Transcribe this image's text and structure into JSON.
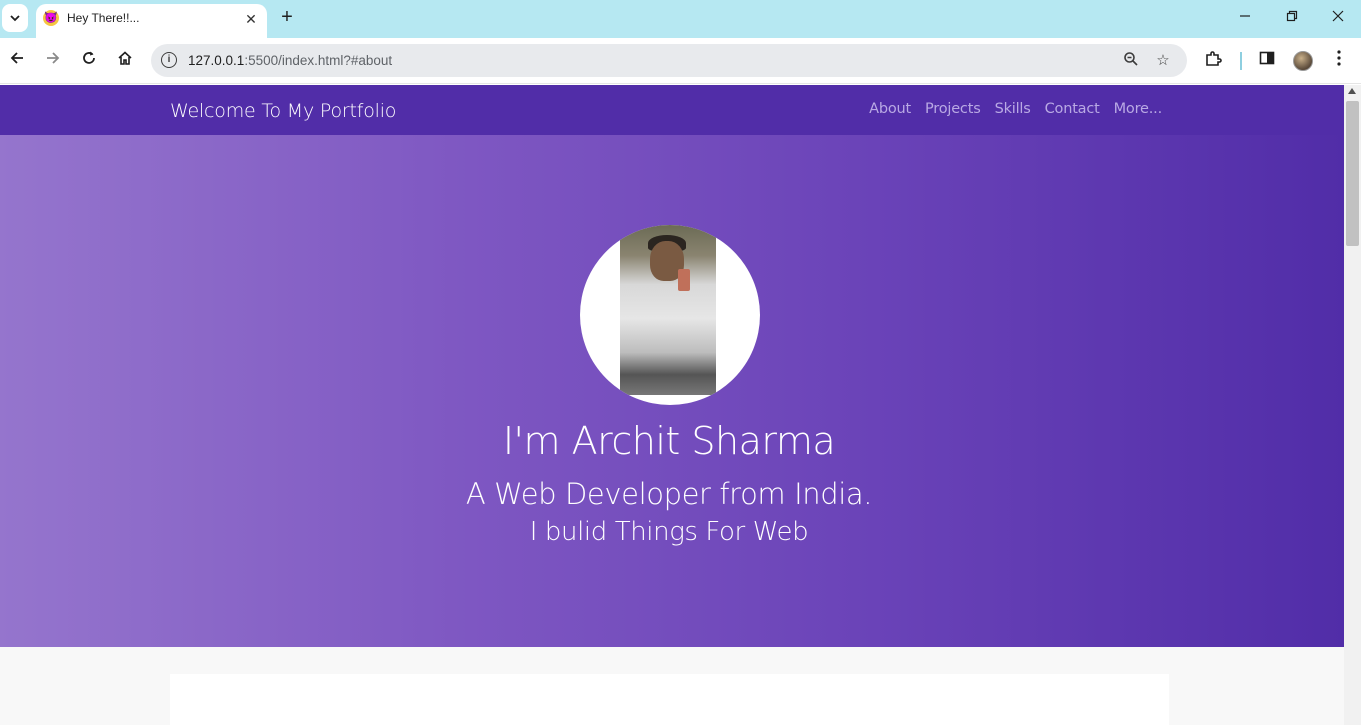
{
  "browser": {
    "tab_title": "Hey There!!...",
    "tab_favicon": "😈",
    "url_host": "127.0.0.1",
    "url_path": ":5500/index.html?#about",
    "icons": {
      "tab_search": "chevron-down-icon",
      "new_tab": "plus-icon",
      "back": "arrow-left-icon",
      "forward": "arrow-right-icon",
      "reload": "reload-icon",
      "home": "home-icon",
      "zoom": "zoom-icon",
      "bookmark": "star-icon",
      "extensions": "puzzle-icon",
      "side_panel": "side-panel-icon",
      "menu": "kebab-menu-icon"
    }
  },
  "nav": {
    "brand": "Welcome To My Portfolio",
    "links": [
      "About",
      "Projects",
      "Skills",
      "Contact",
      "More..."
    ]
  },
  "hero": {
    "name": "I'm Archit Sharma",
    "tagline": "A Web Developer from India.",
    "subtagline": "I bulid Things For Web"
  },
  "colors": {
    "nav_bg": "#512da8",
    "hero_gradient_start": "#9575cd",
    "hero_gradient_end": "#512da8",
    "tabstrip_bg": "#b6e8f2"
  }
}
